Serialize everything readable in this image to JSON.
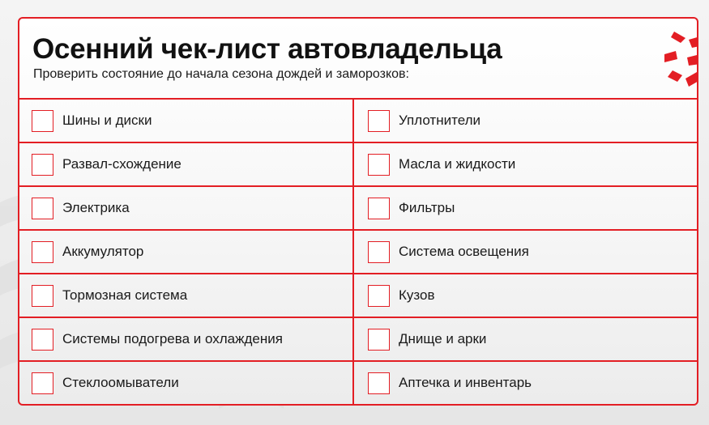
{
  "header": {
    "title": "Осенний чек-лист автовладельца",
    "subtitle": "Проверить состояние до начала сезона дождей и заморозков:"
  },
  "colors": {
    "accent": "#e31e24",
    "text": "#111111",
    "background": "#ececec"
  },
  "checklist": {
    "left": [
      {
        "label": "Шины и диски",
        "checked": false
      },
      {
        "label": "Развал-схождение",
        "checked": false
      },
      {
        "label": "Электрика",
        "checked": false
      },
      {
        "label": "Аккумулятор",
        "checked": false
      },
      {
        "label": "Тормозная система",
        "checked": false
      },
      {
        "label": "Системы подогрева и охлаждения",
        "checked": false
      },
      {
        "label": "Стеклоомыватели",
        "checked": false
      }
    ],
    "right": [
      {
        "label": "Уплотнители",
        "checked": false
      },
      {
        "label": "Масла и жидкости",
        "checked": false
      },
      {
        "label": "Фильтры",
        "checked": false
      },
      {
        "label": "Система освещения",
        "checked": false
      },
      {
        "label": "Кузов",
        "checked": false
      },
      {
        "label": "Днище и арки",
        "checked": false
      },
      {
        "label": "Аптечка и инвентарь",
        "checked": false
      }
    ]
  },
  "icons": {
    "logo": "brand-logo-icon",
    "checkbox": "checkbox-icon"
  }
}
